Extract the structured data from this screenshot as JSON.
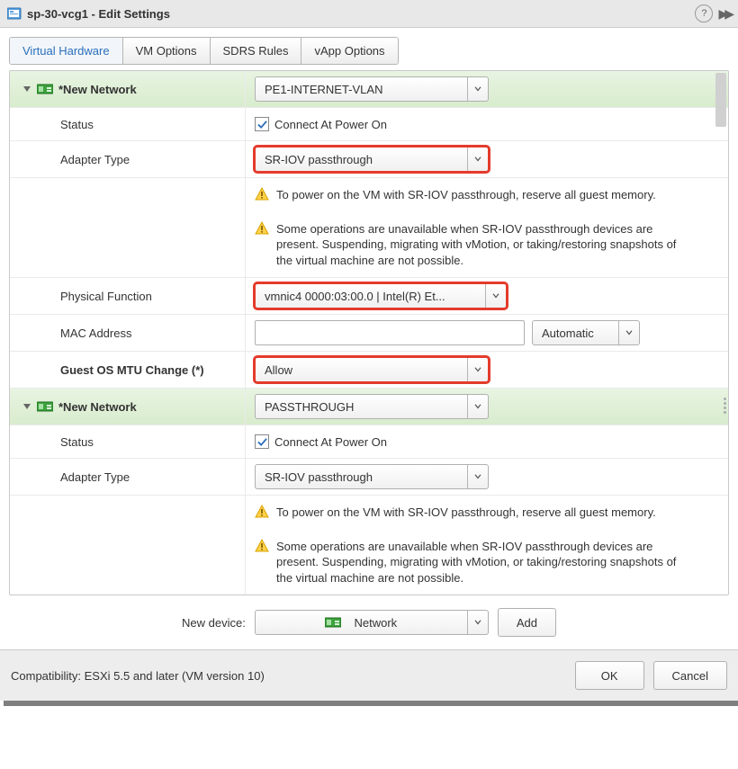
{
  "title": "sp-30-vcg1 - Edit Settings",
  "tabs": [
    "Virtual Hardware",
    "VM Options",
    "SDRS Rules",
    "vApp Options"
  ],
  "net1": {
    "header": "*New Network",
    "network_value": "PE1-INTERNET-VLAN",
    "status_label": "Status",
    "connect_label": "Connect At Power On",
    "adapter_label": "Adapter Type",
    "adapter_value": "SR-IOV passthrough",
    "warn1": "To power on the VM with SR-IOV passthrough, reserve all guest memory.",
    "warn2": "Some operations are unavailable when SR-IOV passthrough devices are present. Suspending, migrating with vMotion, or taking/restoring snapshots of the virtual machine are not possible.",
    "pf_label": "Physical Function",
    "pf_value": "vmnic4 0000:03:00.0 | Intel(R) Et...",
    "mac_label": "MAC Address",
    "mac_mode": "Automatic",
    "mtu_label": "Guest OS MTU Change (*)",
    "mtu_value": "Allow"
  },
  "net2": {
    "header": "*New Network",
    "network_value": "PASSTHROUGH",
    "status_label": "Status",
    "connect_label": "Connect At Power On",
    "adapter_label": "Adapter Type",
    "adapter_value": "SR-IOV passthrough",
    "warn1": "To power on the VM with SR-IOV passthrough, reserve all guest memory.",
    "warn2": "Some operations are unavailable when SR-IOV passthrough devices are present. Suspending, migrating with vMotion, or taking/restoring snapshots of the virtual machine are not possible."
  },
  "newdev_label": "New device:",
  "newdev_value": "Network",
  "add_label": "Add",
  "compat": "Compatibility: ESXi 5.5 and later (VM version 10)",
  "ok": "OK",
  "cancel": "Cancel"
}
